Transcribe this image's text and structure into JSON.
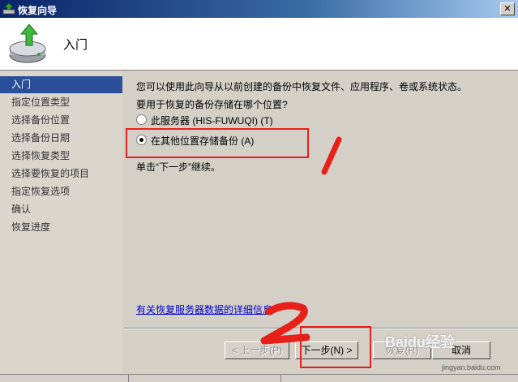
{
  "window": {
    "title": "恢复向导",
    "close_glyph": "✕",
    "app_icon": "backup-icon"
  },
  "header": {
    "title": "入门",
    "icon": "restore-disk-icon"
  },
  "sidebar": {
    "items": [
      {
        "label": "入门",
        "active": true
      },
      {
        "label": "指定位置类型"
      },
      {
        "label": "选择备份位置"
      },
      {
        "label": "选择备份日期"
      },
      {
        "label": "选择恢复类型"
      },
      {
        "label": "选择要恢复的项目"
      },
      {
        "label": "指定恢复选项"
      },
      {
        "label": "确认"
      },
      {
        "label": "恢复进度"
      }
    ]
  },
  "content": {
    "intro": "您可以使用此向导从以前创建的备份中恢复文件、应用程序、卷或系统状态。",
    "question": "要用于恢复的备份存储在哪个位置?",
    "options": [
      {
        "label": "此服务器 (HIS-FUWUQI) (T)",
        "selected": false
      },
      {
        "label": "在其他位置存储备份 (A)",
        "selected": true
      }
    ],
    "continue_hint": "单击“下一步”继续。",
    "more_info_link": "有关恢复服务器数据的详细信息"
  },
  "buttons": {
    "back": "< 上一步(P)",
    "next": "下一步(N) >",
    "recover": "恢复(R)",
    "cancel": "取消"
  },
  "annotations": {
    "mark_1": "1",
    "mark_2": "2",
    "color": "#e8201a"
  },
  "watermark": {
    "brand": "Baidu经验",
    "url": "jingyan.baidu.com"
  }
}
